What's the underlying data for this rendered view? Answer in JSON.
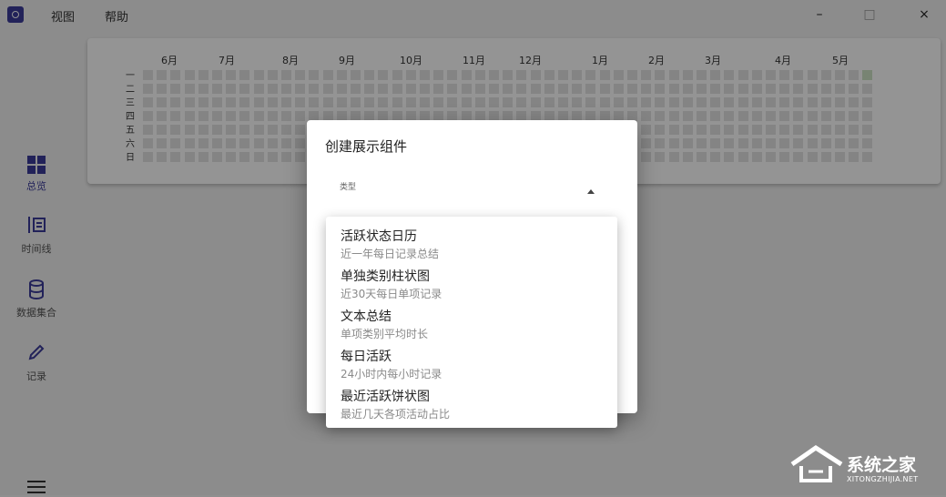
{
  "menu": {
    "view": "视图",
    "help": "帮助"
  },
  "window_controls": {
    "minimize": "–",
    "maximize": "□",
    "close": "×"
  },
  "sidebar": {
    "items": [
      {
        "label": "总览",
        "icon": "dashboard-icon",
        "active": true
      },
      {
        "label": "时间线",
        "icon": "timeline-icon",
        "active": false
      },
      {
        "label": "数据集合",
        "icon": "database-icon",
        "active": false
      },
      {
        "label": "记录",
        "icon": "pencil-icon",
        "active": false
      }
    ]
  },
  "calendar": {
    "months": [
      "6月",
      "7月",
      "8月",
      "9月",
      "10月",
      "11月",
      "12月",
      "1月",
      "2月",
      "3月",
      "4月",
      "5月"
    ],
    "weekdays": [
      "一",
      "二",
      "三",
      "四",
      "五",
      "六",
      "日"
    ]
  },
  "dialog": {
    "title": "创建展示组件",
    "select_label": "类型",
    "options": [
      {
        "title": "活跃状态日历",
        "subtitle": "近一年每日记录总结"
      },
      {
        "title": "单独类别柱状图",
        "subtitle": "近30天每日单项记录"
      },
      {
        "title": "文本总结",
        "subtitle": "单项类别平均时长"
      },
      {
        "title": "每日活跃",
        "subtitle": "24小时内每小时记录"
      },
      {
        "title": "最近活跃饼状图",
        "subtitle": "最近几天各项活动占比"
      }
    ]
  },
  "watermark": {
    "name": "系统之家",
    "url": "XITONGZHIJIA.NET"
  }
}
